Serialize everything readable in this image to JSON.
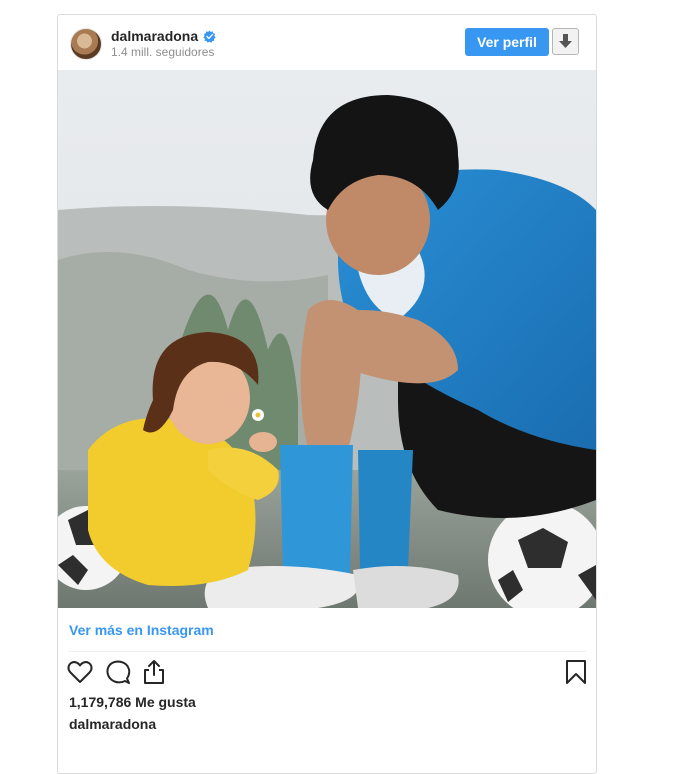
{
  "post": {
    "username": "dalmaradona",
    "followers": "1.4 mill. seguidores",
    "view_profile_label": "Ver perfil",
    "view_more_label": "Ver más en Instagram",
    "likes": "1,179,786 Me gusta",
    "caption_username": "dalmaradona"
  },
  "icons": {
    "verified": "verified-badge-icon",
    "download": "download-arrow-icon",
    "like": "heart-icon",
    "comment": "comment-bubble-icon",
    "share": "share-icon",
    "save": "bookmark-icon"
  },
  "colors": {
    "accent": "#3897f0",
    "text": "#262626",
    "muted": "#8e8e8e"
  }
}
